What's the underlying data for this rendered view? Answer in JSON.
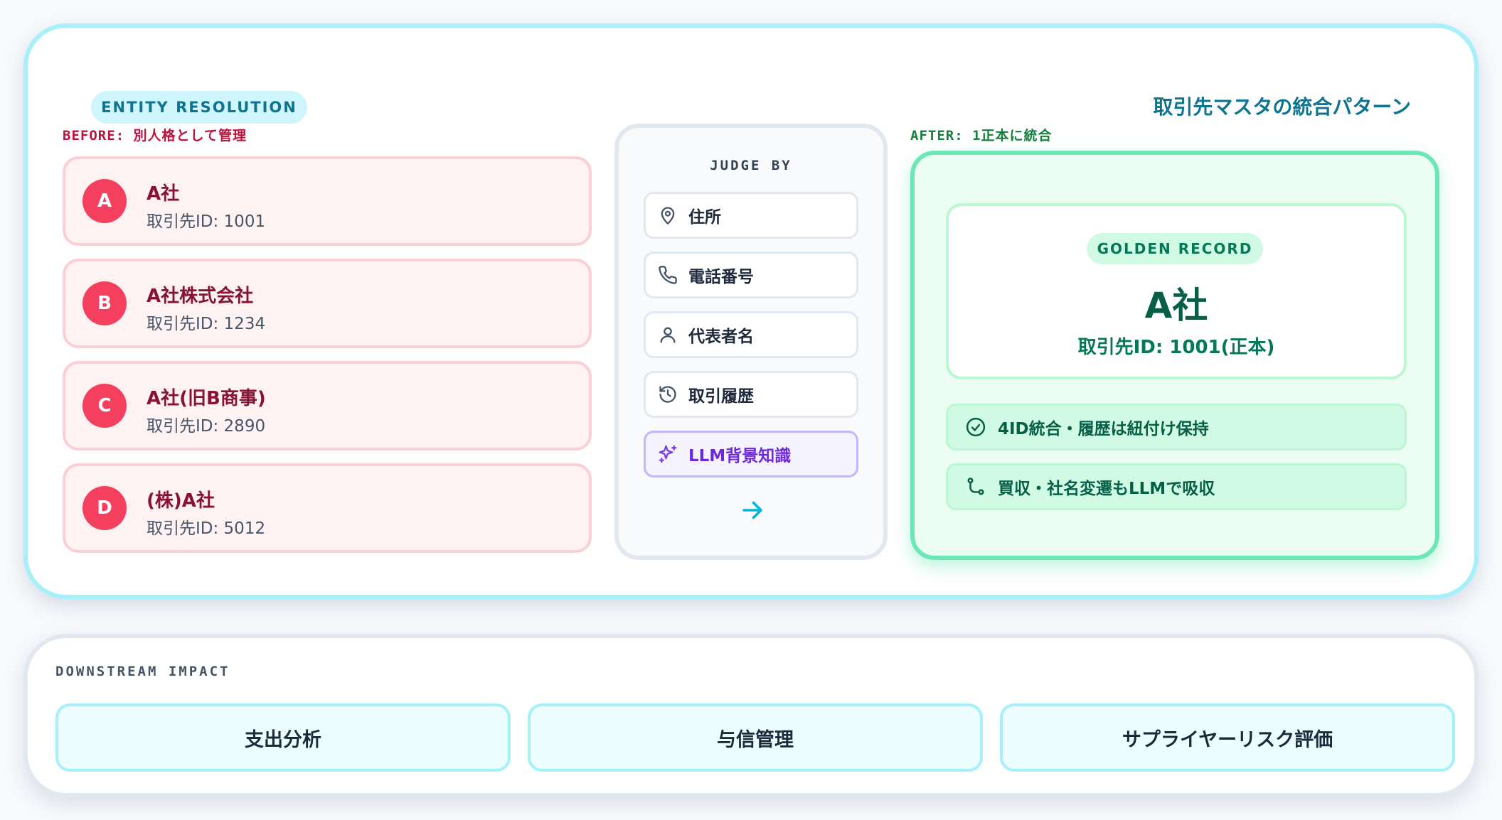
{
  "header": {
    "tag": "ENTITY RESOLUTION",
    "title": "取引先マスタの統合パターン"
  },
  "before": {
    "label": "BEFORE: 別人格として管理",
    "entities": [
      {
        "badge": "A",
        "name": "A社",
        "id": "取引先ID: 1001"
      },
      {
        "badge": "B",
        "name": "A社株式会社",
        "id": "取引先ID: 1234"
      },
      {
        "badge": "C",
        "name": "A社(旧B商事)",
        "id": "取引先ID: 2890"
      },
      {
        "badge": "D",
        "name": "(株)A社",
        "id": "取引先ID: 5012"
      }
    ]
  },
  "judge": {
    "title": "JUDGE BY",
    "items": [
      {
        "label": "住所",
        "icon": "map-pin-icon"
      },
      {
        "label": "電話番号",
        "icon": "phone-icon"
      },
      {
        "label": "代表者名",
        "icon": "user-icon"
      },
      {
        "label": "取引履歴",
        "icon": "history-icon"
      },
      {
        "label": "LLM背景知識",
        "icon": "sparkles-icon"
      }
    ],
    "arrow_icon": "arrow-right-icon"
  },
  "after": {
    "label": "AFTER: 1正本に統合",
    "golden": {
      "tag": "GOLDEN RECORD",
      "name": "A社",
      "id": "取引先ID: 1001(正本)"
    },
    "features": [
      {
        "label": "4ID統合・履歴は紐付け保持",
        "icon": "check-circle-icon"
      },
      {
        "label": "買収・社名変遷もLLMで吸収",
        "icon": "git-branch-icon"
      }
    ]
  },
  "downstream": {
    "label": "DOWNSTREAM IMPACT",
    "items": [
      "支出分析",
      "与信管理",
      "サプライヤーリスク評価"
    ]
  },
  "colors": {
    "accent_cyan": "#0e7490",
    "before_red": "#be123c",
    "badge_red": "#f43f5e",
    "after_green": "#15803d",
    "llm_purple": "#6d28d9"
  }
}
